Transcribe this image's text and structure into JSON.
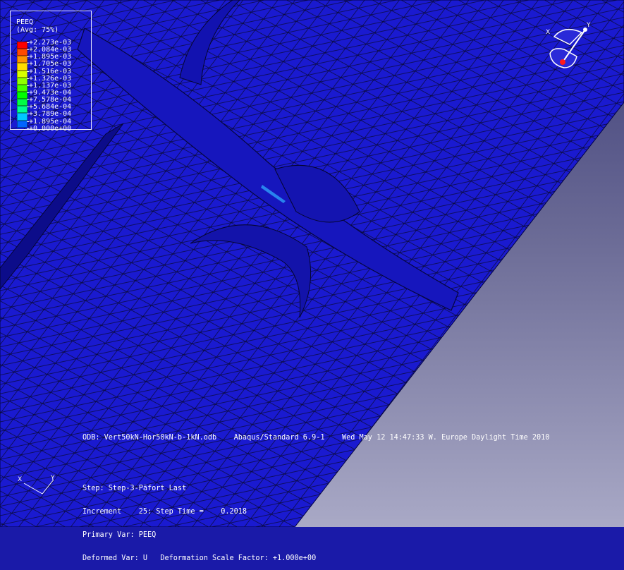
{
  "legend": {
    "title": "PEEQ",
    "avg": "(Avg: 75%)",
    "entries": [
      {
        "label": "+2.273e-03",
        "color": "#ff0000"
      },
      {
        "label": "+2.084e-03",
        "color": "#ff4a00"
      },
      {
        "label": "+1.895e-03",
        "color": "#ff9400"
      },
      {
        "label": "+1.705e-03",
        "color": "#ffdd00"
      },
      {
        "label": "+1.516e-03",
        "color": "#d9ff00"
      },
      {
        "label": "+1.326e-03",
        "color": "#8fff00"
      },
      {
        "label": "+1.137e-03",
        "color": "#46ff00"
      },
      {
        "label": "+9.473e-04",
        "color": "#00ff00"
      },
      {
        "label": "+7.578e-04",
        "color": "#00ff46"
      },
      {
        "label": "+5.684e-04",
        "color": "#00ff8f"
      },
      {
        "label": "+3.789e-04",
        "color": "#00c8ff"
      },
      {
        "label": "+1.895e-04",
        "color": "#0064ff"
      },
      {
        "label": "+0.000e+00",
        "color": "#0000ff"
      }
    ]
  },
  "info": {
    "odb_line": "ODB: Vert50kN-Hor50kN-b-1kN.odb    Abaqus/Standard 6.9-1    Wed May 12 14:47:33 W. Europe Daylight Time 2010",
    "step_line": "Step: Step-3-Päfort Last",
    "increment_line": "Increment    25: Step Time =    0.2018",
    "primary_var_line": "Primary Var: PEEQ",
    "deformed_var_line": "Deformed Var: U   Deformation Scale Factor: +1.000e+00"
  },
  "triad": {
    "x_label": "X",
    "y_label": "Y"
  },
  "colors": {
    "mesh_fill": "#1a1ad0",
    "mesh_line": "#0a0a3a",
    "background_top": "#3e3e78",
    "background_bottom": "#a9a9c6",
    "hotspot": "#2fa8ff"
  }
}
